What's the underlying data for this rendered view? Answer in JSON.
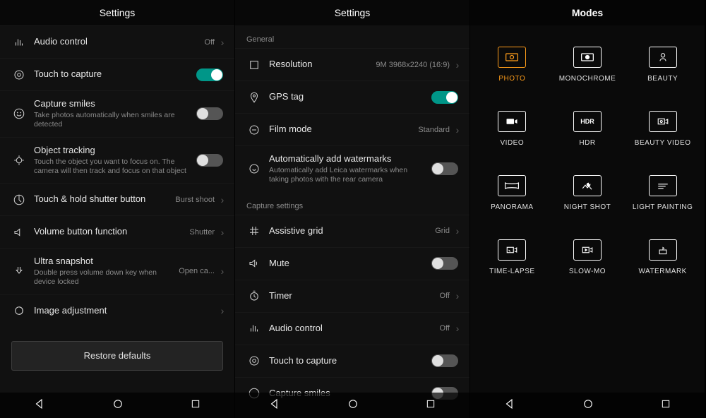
{
  "panel1": {
    "title": "Settings",
    "rows": [
      {
        "label": "Audio control",
        "value": "Off"
      },
      {
        "label": "Touch to capture",
        "toggleOn": true
      },
      {
        "label": "Capture smiles",
        "sub": "Take photos automatically when smiles are detected",
        "toggleOn": false
      },
      {
        "label": "Object tracking",
        "sub": "Touch the object you want to focus on. The camera will then track and focus on that object",
        "toggleOn": false
      },
      {
        "label": "Touch & hold shutter button",
        "value": "Burst shoot"
      },
      {
        "label": "Volume button function",
        "value": "Shutter"
      },
      {
        "label": "Ultra snapshot",
        "sub": "Double press volume down key when device locked",
        "value": "Open ca..."
      },
      {
        "label": "Image adjustment"
      }
    ],
    "restore": "Restore defaults"
  },
  "panel2": {
    "title": "Settings",
    "section1": "General",
    "section2": "Capture settings",
    "rows1": [
      {
        "label": "Resolution",
        "value": "9M 3968x2240 (16:9)"
      },
      {
        "label": "GPS tag",
        "toggleOn": true
      },
      {
        "label": "Film mode",
        "value": "Standard"
      },
      {
        "label": "Automatically add watermarks",
        "sub": "Automatically add Leica watermarks when taking photos with the rear camera",
        "toggleOn": false
      }
    ],
    "rows2": [
      {
        "label": "Assistive grid",
        "value": "Grid"
      },
      {
        "label": "Mute",
        "toggleOn": false
      },
      {
        "label": "Timer",
        "value": "Off"
      },
      {
        "label": "Audio control",
        "value": "Off"
      },
      {
        "label": "Touch to capture",
        "toggleOn": false
      },
      {
        "label": "Capture smiles",
        "toggleOn": false
      }
    ]
  },
  "panel3": {
    "title": "Modes",
    "modes": [
      {
        "label": "PHOTO",
        "active": true
      },
      {
        "label": "MONOCHROME"
      },
      {
        "label": "BEAUTY"
      },
      {
        "label": "VIDEO"
      },
      {
        "label": "HDR"
      },
      {
        "label": "BEAUTY VIDEO"
      },
      {
        "label": "PANORAMA"
      },
      {
        "label": "NIGHT SHOT"
      },
      {
        "label": "LIGHT PAINTING"
      },
      {
        "label": "TIME-LAPSE"
      },
      {
        "label": "SLOW-MO"
      },
      {
        "label": "WATERMARK"
      }
    ]
  }
}
